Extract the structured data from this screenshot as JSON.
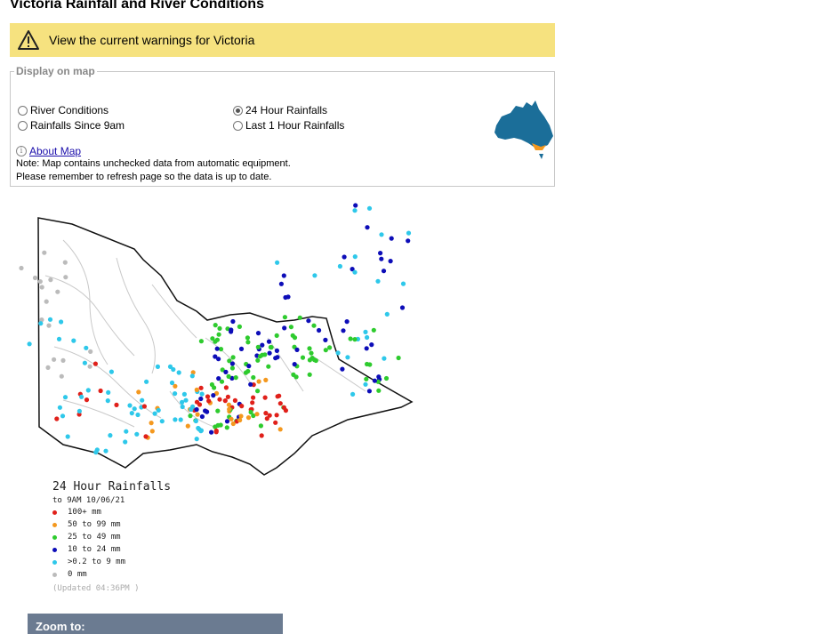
{
  "page": {
    "title": "Victoria Rainfall and River Conditions"
  },
  "warning": {
    "text": "View the current warnings for Victoria",
    "icon": "warning-triangle-icon",
    "color": "#f6e27f"
  },
  "display": {
    "legend": "Display on map",
    "options": [
      {
        "label": "River Conditions",
        "selected": false
      },
      {
        "label": "Rainfalls Since 9am",
        "selected": false
      },
      {
        "label": "24 Hour Rainfalls",
        "selected": true
      },
      {
        "label": "Last 1 Hour Rainfalls",
        "selected": false
      }
    ],
    "about_link": "About Map",
    "note1": "Note: Map contains unchecked data from automatic equipment.",
    "note2": "Please remember to refresh page so the data is up to date."
  },
  "map_legend": {
    "title": "24 Hour Rainfalls",
    "subtitle": "to 9AM 10/06/21",
    "items": [
      {
        "label": "100+ mm",
        "color": "#e0201a"
      },
      {
        "label": "50  to 99 mm",
        "color": "#f4981e"
      },
      {
        "label": "25  to 49 mm",
        "color": "#2ecb2e"
      },
      {
        "label": "10  to 24 mm",
        "color": "#0d0db8"
      },
      {
        "label": ">0.2 to 9 mm",
        "color": "#2ec8ea"
      },
      {
        "label": "0 mm",
        "color": "#bbbbbb"
      }
    ],
    "updated": "(Updated 04:36PM  )"
  },
  "zoom": {
    "label": "Zoom to:"
  }
}
